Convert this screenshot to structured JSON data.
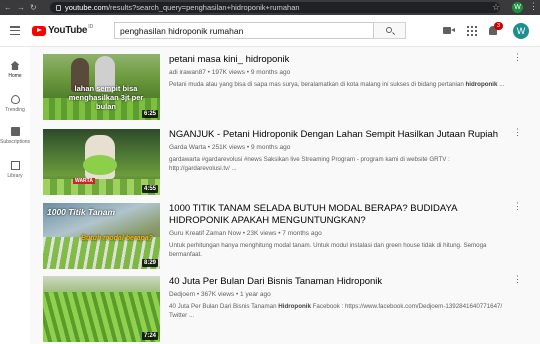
{
  "browser": {
    "url_host": "youtube.com",
    "url_path": "/results?search_query=penghasilan+hidroponik+rumahan",
    "profile_initial": "W"
  },
  "header": {
    "logo_text": "YouTube",
    "logo_region": "ID",
    "search_value": "penghasilan hidroponik rumahan",
    "notification_count": "3",
    "avatar_initial": "W"
  },
  "sidebar": {
    "items": [
      {
        "label": "Home",
        "icon": "home-icon"
      },
      {
        "label": "Trending",
        "icon": "trending-icon"
      },
      {
        "label": "Subscriptions",
        "icon": "subscriptions-icon"
      },
      {
        "label": "Library",
        "icon": "library-icon"
      }
    ]
  },
  "videos": [
    {
      "title": "petani masa kini_ hidroponik",
      "channel": "adi irawan87",
      "views": "197K views",
      "age": "9 months ago",
      "desc_pre": "Petani muda atau yang bisa di sapa mas surya, beralamatkan di kota malang ini sukses di bidang pertanian ",
      "desc_bold": "hidroponik",
      "desc_post": " ...",
      "duration": "6:25",
      "thumb_text": "lahan sempit bisa menghasilkan 3jt per bulan"
    },
    {
      "title": "NGANJUK - Petani Hidroponik Dengan Lahan Sempit Hasilkan Jutaan Rupiah",
      "channel": "Garda Warta",
      "views": "251K views",
      "age": "9 months ago",
      "desc_pre": "gardawarta #gardarevolusi #news Saksikan live Streaming Program - program kami di website GRTV : http://gardarevolusi.tv/ ...",
      "desc_bold": "",
      "desc_post": "",
      "duration": "4:55",
      "thumb_text": "WARTA"
    },
    {
      "title": "1000 TITIK TANAM SELADA BUTUH MODAL BERAPA? BUDIDAYA HIDROPONIK APAKAH MENGUNTUNGKAN?",
      "channel": "Guru Kreatif Zaman Now",
      "views": "23K views",
      "age": "7 months ago",
      "desc_pre": "Untuk perhitungan hanya menghitung modal tanam. Untuk modul instalasi dan green house tidak di hitung. Semoga bermanfaat.",
      "desc_bold": "",
      "desc_post": "",
      "duration": "8:29",
      "thumb_text": "1000 Titik Tanam",
      "thumb_text2": "Butuh modal berapa?"
    },
    {
      "title": "40 Juta Per Bulan Dari Bisnis Tanaman Hidroponik",
      "channel": "Dedjoem",
      "views": "367K views",
      "age": "1 year ago",
      "desc_pre": "40 Juta Per Bulan Dari Bisnis Tanaman ",
      "desc_bold": "Hidroponik",
      "desc_post": " Facebook : https://www.facebook.com/Dedjoem-1392841640771647/ Twitter ...",
      "duration": "7:24",
      "thumb_text": ""
    }
  ]
}
